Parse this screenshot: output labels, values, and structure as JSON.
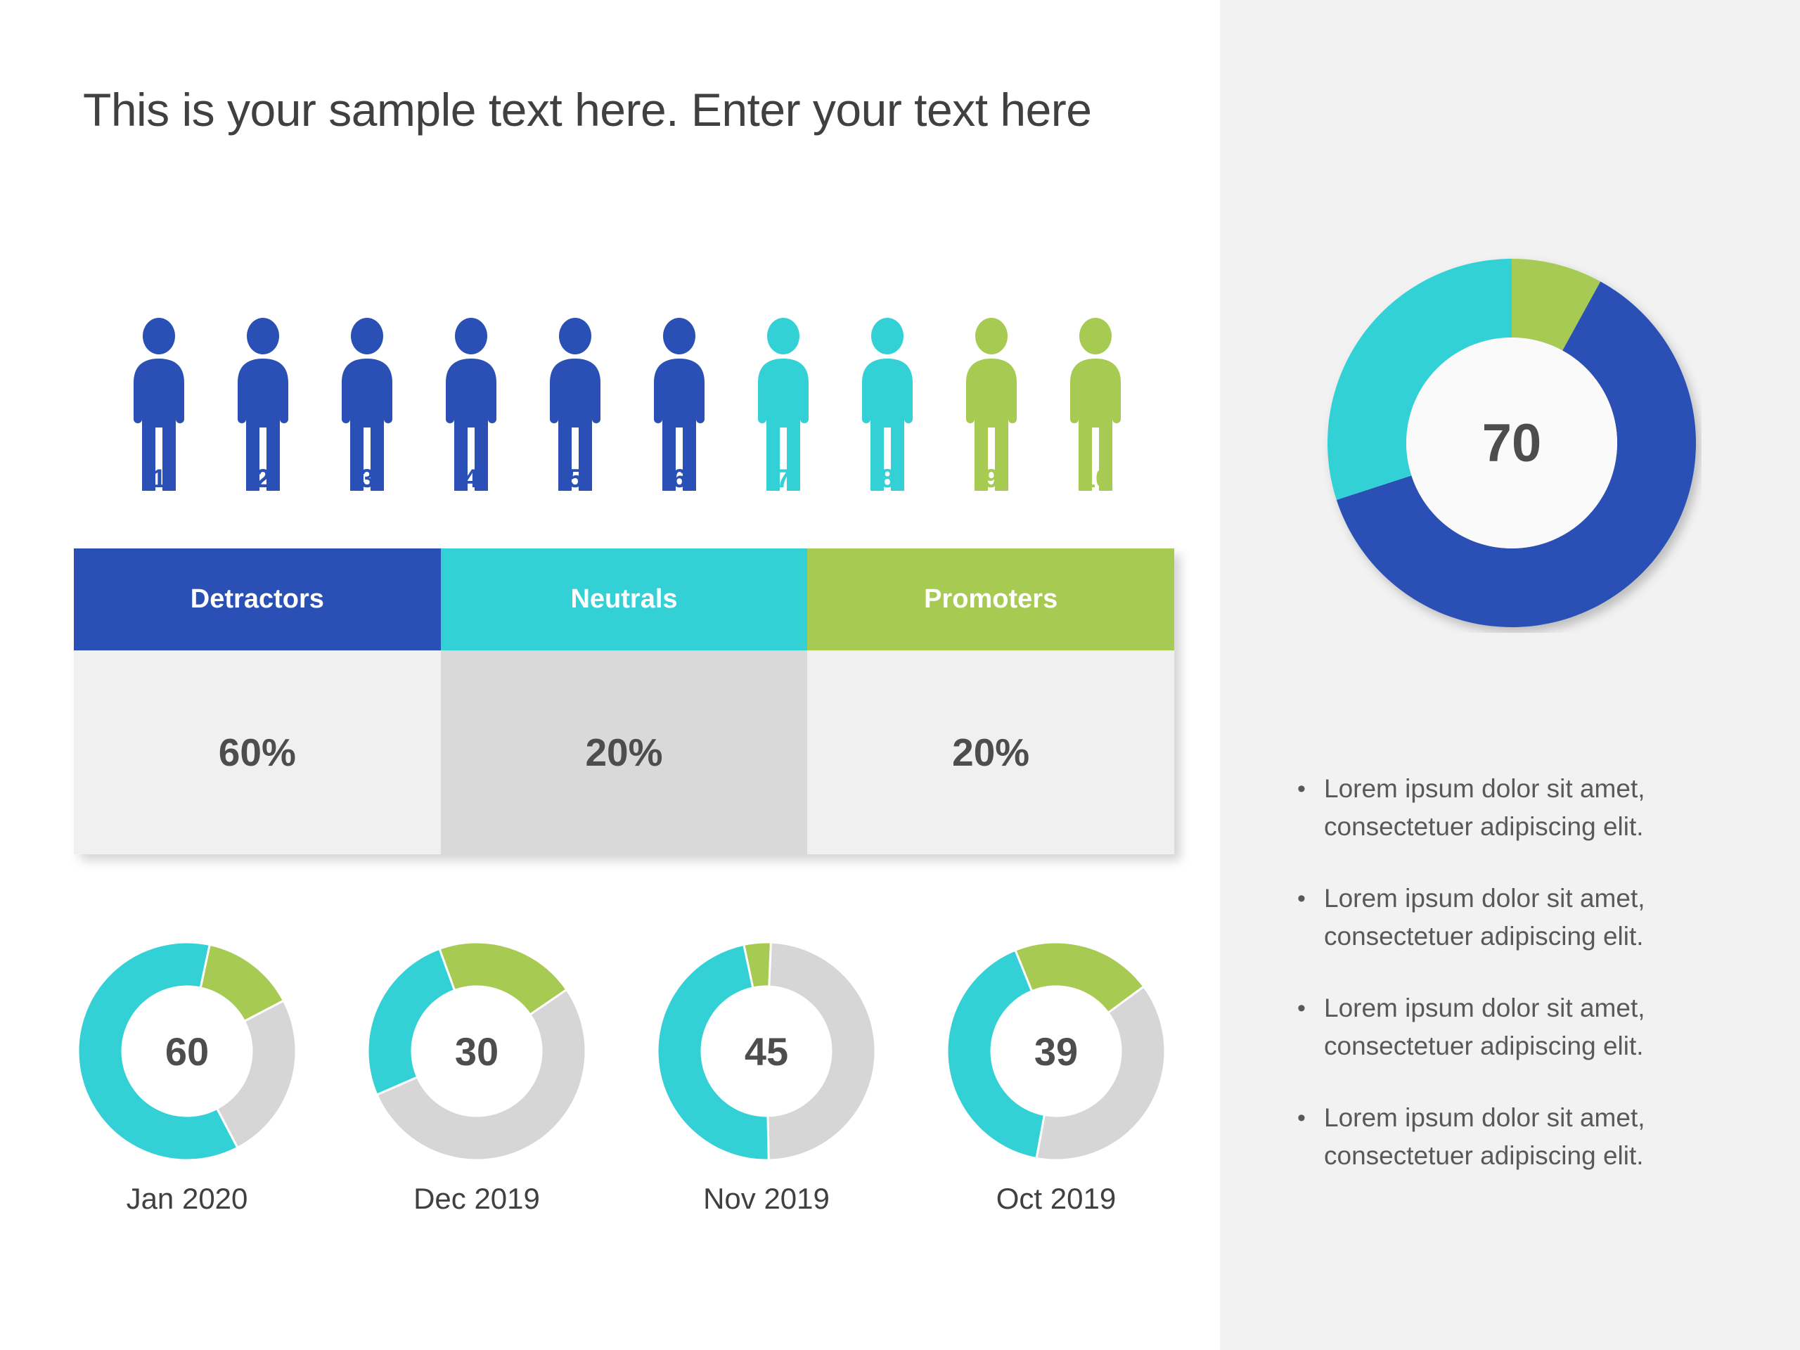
{
  "title": "This is your sample text here. Enter your text here",
  "colors": {
    "detractor_blue": "#2B50B5",
    "neutral_cyan": "#33D1D6",
    "promoter_green": "#A6CA52",
    "track_gray": "#D6D6D6",
    "text_dark": "#4D4D4D",
    "panel_bg": "#F2F2F2",
    "cell_light": "#F0F0F0",
    "cell_dark": "#D9D9D9"
  },
  "people": {
    "icons": [
      {
        "number": "1",
        "color": "#2B50B5"
      },
      {
        "number": "2",
        "color": "#2B50B5"
      },
      {
        "number": "3",
        "color": "#2B50B5"
      },
      {
        "number": "4",
        "color": "#2B50B5"
      },
      {
        "number": "5",
        "color": "#2B50B5"
      },
      {
        "number": "6",
        "color": "#2B50B5"
      },
      {
        "number": "7",
        "color": "#33D1D6"
      },
      {
        "number": "8",
        "color": "#33D1D6"
      },
      {
        "number": "9",
        "color": "#A6CA52"
      },
      {
        "number": "10",
        "color": "#A6CA52"
      }
    ]
  },
  "table": {
    "headers": [
      "Detractors",
      "Neutrals",
      "Promoters"
    ],
    "header_colors": [
      "#2B50B5",
      "#33D1D6",
      "#A6CA52"
    ],
    "values": [
      "60%",
      "20%",
      "20%"
    ],
    "cell_colors": [
      "#F0F0F0",
      "#D9D9D9",
      "#F0F0F0"
    ]
  },
  "bullets": [
    "Lorem ipsum dolor sit amet, consectetuer adipiscing elit.",
    "Lorem ipsum dolor sit amet, consectetuer adipiscing elit.",
    "Lorem ipsum dolor sit amet, consectetuer adipiscing elit.",
    "Lorem ipsum dolor sit amet, consectetuer adipiscing elit."
  ],
  "bullet_marker": "•",
  "chart_data": [
    {
      "type": "pie",
      "name": "nps-main-donut",
      "title": "",
      "center_label": "70",
      "donut": true,
      "labels": [
        "Promoters",
        "Detractors",
        "Neutrals"
      ],
      "values": [
        8,
        62,
        30
      ],
      "colors": [
        "#A6CA52",
        "#2B50B5",
        "#33D1D6"
      ],
      "legend": "none"
    },
    {
      "type": "pie",
      "name": "donut-jan-2020",
      "title": "Jan 2020",
      "center_label": "60",
      "donut": true,
      "labels": [
        "Promoters",
        "Neutrals",
        "Detractors"
      ],
      "values": [
        14,
        25,
        61
      ],
      "colors": [
        "#A6CA52",
        "#D6D6D6",
        "#33D1D6"
      ],
      "legend": "none"
    },
    {
      "type": "pie",
      "name": "donut-dec-2019",
      "title": "Dec 2019",
      "center_label": "30",
      "donut": true,
      "labels": [
        "Promoters",
        "Neutrals",
        "Detractors"
      ],
      "values": [
        21,
        53,
        26
      ],
      "colors": [
        "#A6CA52",
        "#D6D6D6",
        "#33D1D6"
      ],
      "legend": "none"
    },
    {
      "type": "pie",
      "name": "donut-nov-2019",
      "title": "Nov 2019",
      "center_label": "45",
      "donut": true,
      "labels": [
        "Promoters",
        "Neutrals",
        "Detractors"
      ],
      "values": [
        4,
        49,
        47
      ],
      "colors": [
        "#A6CA52",
        "#D6D6D6",
        "#33D1D6"
      ],
      "legend": "none"
    },
    {
      "type": "pie",
      "name": "donut-oct-2019",
      "title": "Oct 2019",
      "center_label": "39",
      "donut": true,
      "labels": [
        "Promoters",
        "Neutrals",
        "Detractors"
      ],
      "values": [
        21,
        38,
        41
      ],
      "colors": [
        "#A6CA52",
        "#D6D6D6",
        "#33D1D6"
      ],
      "legend": "none"
    }
  ]
}
